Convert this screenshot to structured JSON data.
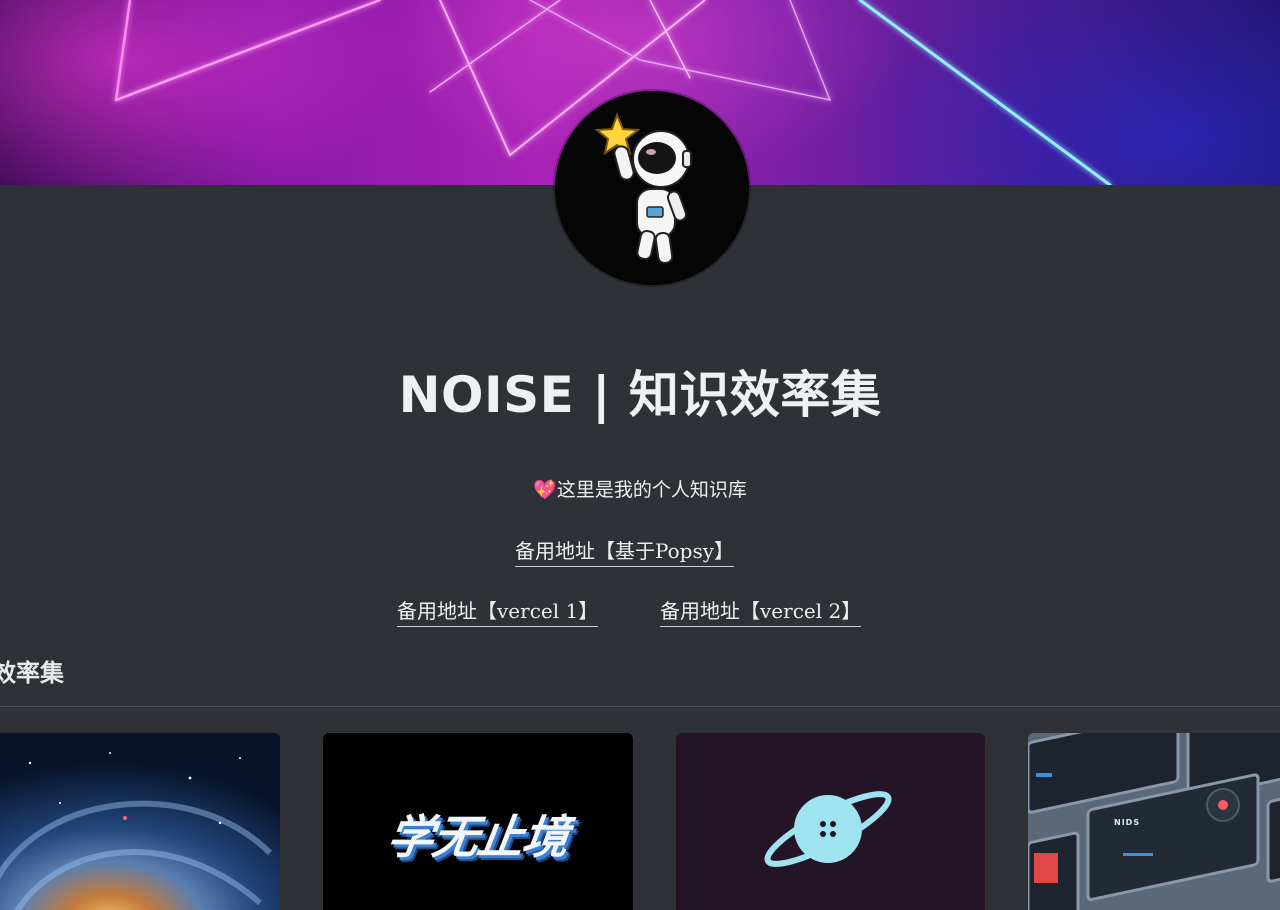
{
  "header": {
    "title": "NOISE | 知识效率集",
    "description": "💖这里是我的个人知识库"
  },
  "links": {
    "popsy": "备用地址【基于Popsy】",
    "vercel1": "备用地址【vercel 1】",
    "vercel2": "备用地址【vercel 2】"
  },
  "section": {
    "heading": "知识效率集"
  },
  "cards": [
    {
      "image": "galaxy-image"
    },
    {
      "image": "learning-image",
      "text": "学无止境"
    },
    {
      "image": "planet-logo-image"
    },
    {
      "image": "dashboard-image",
      "label": "NIDS"
    }
  ],
  "colors": {
    "background": "#2e3236",
    "text": "#eceeef",
    "banner_pink": "#ff4fe6",
    "banner_blue": "#6fd8ff",
    "planet": "#9fe3f1"
  }
}
